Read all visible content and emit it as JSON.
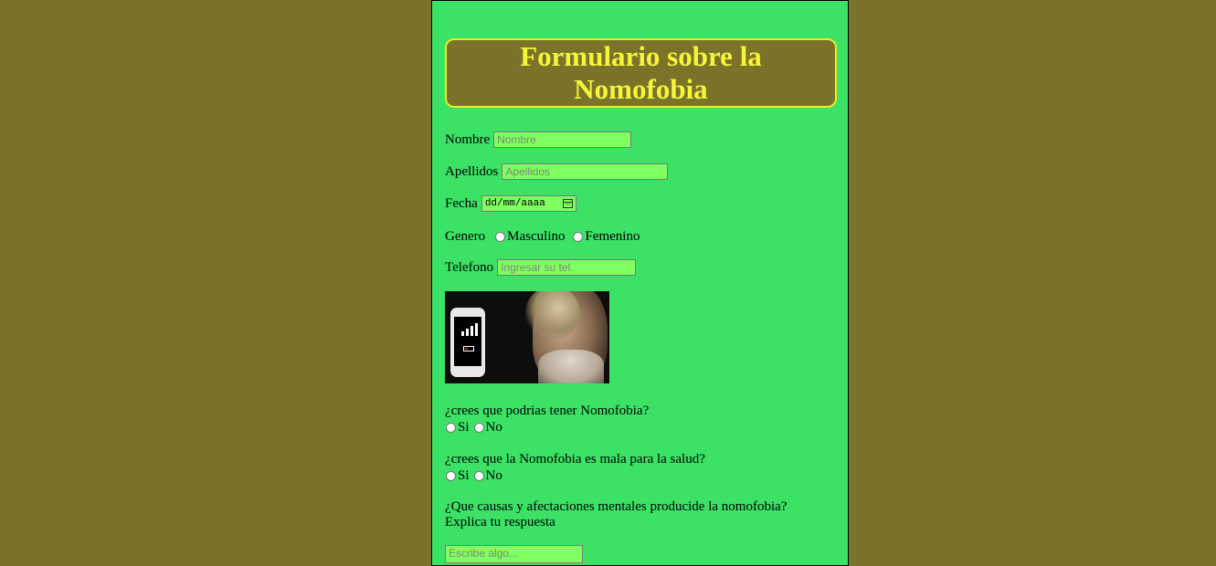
{
  "page": {
    "title": "Formulario sobre la Nomofobia"
  },
  "form": {
    "nombre": {
      "label": "Nombre",
      "placeholder": "Nombre"
    },
    "apellidos": {
      "label": "Apellidos",
      "placeholder": "Apellidos"
    },
    "fecha": {
      "label": "Fecha",
      "placeholder": "dd/mm/aaaa"
    },
    "genero": {
      "label": "Genero",
      "options": [
        "Masculino",
        "Femenino"
      ]
    },
    "telefono": {
      "label": "Telefono",
      "placeholder": "Ingresar su tel."
    }
  },
  "questions": [
    {
      "text": "¿crees que podrias tener Nomofobia?",
      "options": [
        "Si",
        "No"
      ]
    },
    {
      "text": "¿crees que la Nomofobia es mala para la salud?",
      "options": [
        "Si",
        "No"
      ]
    }
  ],
  "open_question": {
    "line1": "¿Que causas y afectaciones mentales producide la nomofobia?",
    "line2": "Explica tu respuesta",
    "placeholder": "Escribe algo..."
  },
  "colors": {
    "background": "#7b732a",
    "panel": "#3be266",
    "title_text": "#f5f53a",
    "input_bg": "#7fff60"
  },
  "image": {
    "icon": "nomofobia-photo"
  }
}
